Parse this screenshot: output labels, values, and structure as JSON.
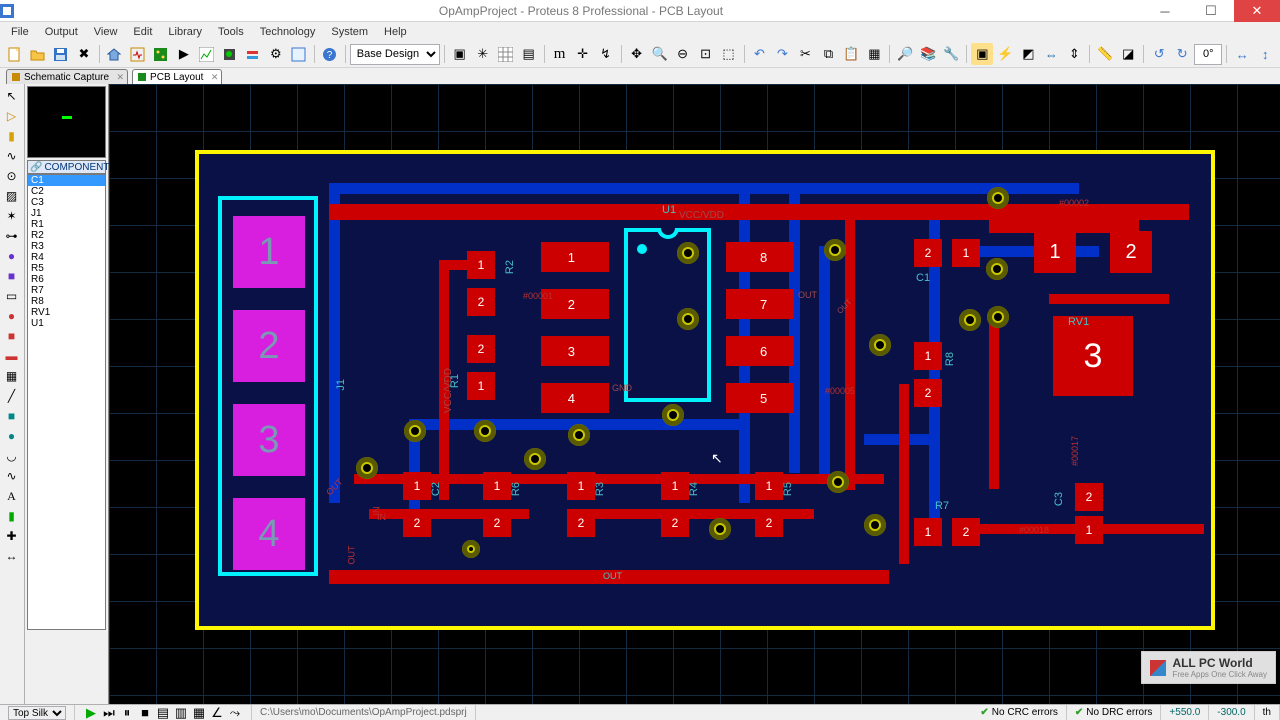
{
  "title": "OpAmpProject - Proteus 8 Professional - PCB Layout",
  "menu": [
    "File",
    "Output",
    "View",
    "Edit",
    "Library",
    "Tools",
    "Technology",
    "System",
    "Help"
  ],
  "base_design_label": "Base Design",
  "rotation_value": "0°",
  "tabs": [
    {
      "label": "Schematic Capture",
      "active": false
    },
    {
      "label": "PCB Layout",
      "active": true
    }
  ],
  "components_header": "COMPONENTS",
  "components": [
    "C1",
    "C2",
    "C3",
    "J1",
    "R1",
    "R2",
    "R3",
    "R4",
    "R5",
    "R6",
    "R7",
    "R8",
    "RV1",
    "U1"
  ],
  "selected_component": "C1",
  "pcb": {
    "refdes": {
      "U1": "U1",
      "C1": "C1",
      "C2": "C2",
      "C3": "C3",
      "J1": "J1",
      "R1": "R1",
      "R2": "R2",
      "R3": "R3",
      "R4": "R4",
      "R5": "R5",
      "R6": "R6",
      "R7": "R7",
      "R8": "R8",
      "RV1": "RV1"
    },
    "power": {
      "vcc": "VCC/VDD",
      "gnd": "GND",
      "out": "OUT",
      "in": "IN"
    },
    "nets": [
      "#00001",
      "#00002",
      "#00005",
      "#00017",
      "#00018"
    ],
    "conn_pins": [
      "1",
      "2",
      "3",
      "4"
    ],
    "ic_pins_left": [
      "1",
      "2",
      "3",
      "4"
    ],
    "ic_pins_right": [
      "8",
      "7",
      "6",
      "5"
    ],
    "rv_big": "3",
    "rv_small": [
      "1",
      "2"
    ]
  },
  "status": {
    "layer_select": "Top Silk",
    "filepath": "C:\\Users\\mo\\Documents\\OpAmpProject.pdsprj",
    "crc": "No CRC errors",
    "drc": "No DRC errors",
    "coord_x": "+550.0",
    "coord_y": "-300.0",
    "unit": "th"
  },
  "watermark": "ALL PC World",
  "watermark_sub": "Free Apps One Click Away"
}
